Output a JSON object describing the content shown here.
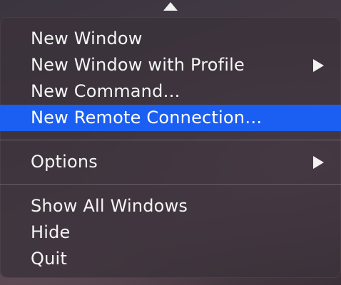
{
  "menu": {
    "items": [
      {
        "label": "New Window",
        "has_submenu": false,
        "selected": false
      },
      {
        "label": "New Window with Profile",
        "has_submenu": true,
        "selected": false
      },
      {
        "label": "New Command…",
        "has_submenu": false,
        "selected": false
      },
      {
        "label": "New Remote Connection…",
        "has_submenu": false,
        "selected": true
      },
      {
        "label": "Options",
        "has_submenu": true,
        "selected": false
      },
      {
        "label": "Show All Windows",
        "has_submenu": false,
        "selected": false
      },
      {
        "label": "Hide",
        "has_submenu": false,
        "selected": false
      },
      {
        "label": "Quit",
        "has_submenu": false,
        "selected": false
      }
    ]
  },
  "colors": {
    "selection": "#1a5ff2",
    "menu_text": "#f5f5f5"
  },
  "icons": {
    "pointer": "caret-up-icon",
    "submenu": "triangle-right-icon"
  }
}
